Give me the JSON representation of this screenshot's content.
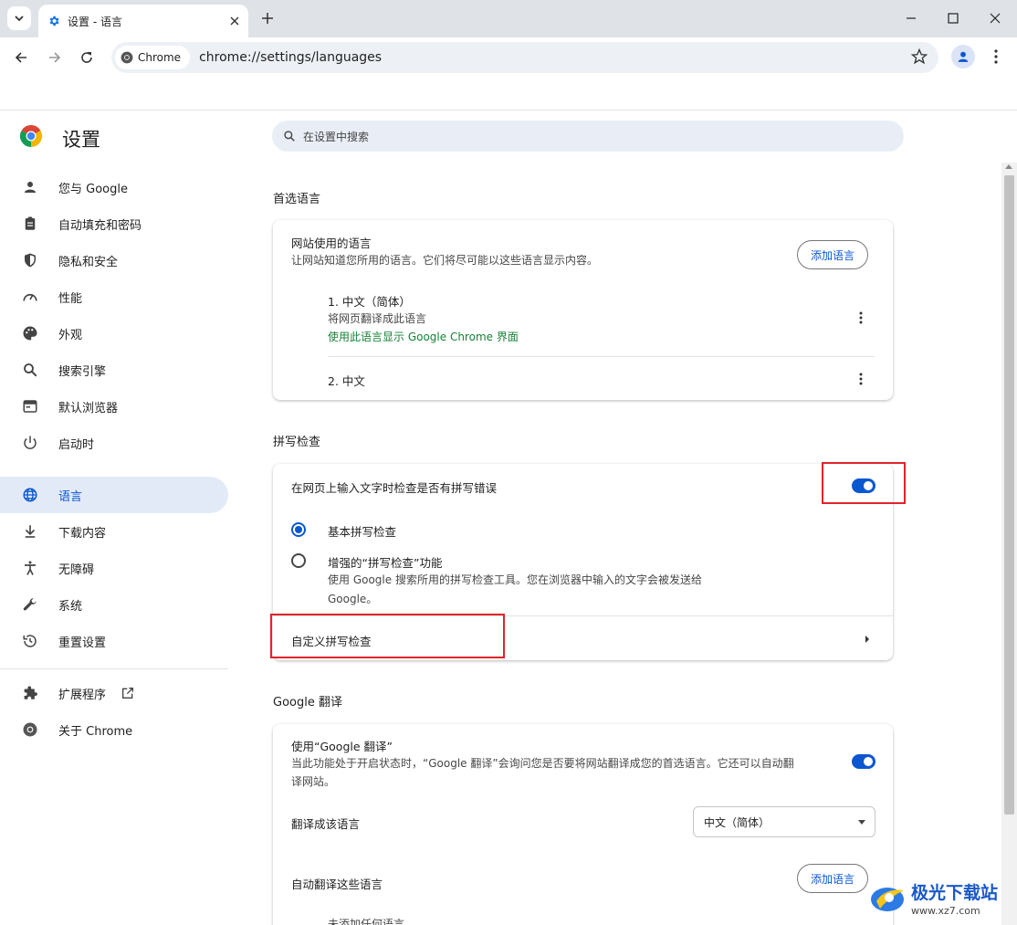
{
  "browser": {
    "tab_title": "设置 - 语言",
    "chip_label": "Chrome",
    "url": "chrome://settings/languages"
  },
  "settings": {
    "title": "设置",
    "search_placeholder": "在设置中搜索"
  },
  "sidebar": {
    "items": [
      {
        "label": "您与 Google",
        "icon": "person-icon"
      },
      {
        "label": "自动填充和密码",
        "icon": "clipboard-icon"
      },
      {
        "label": "隐私和安全",
        "icon": "shield-icon"
      },
      {
        "label": "性能",
        "icon": "speedometer-icon"
      },
      {
        "label": "外观",
        "icon": "palette-icon"
      },
      {
        "label": "搜索引擎",
        "icon": "search-icon"
      },
      {
        "label": "默认浏览器",
        "icon": "browser-window-icon"
      },
      {
        "label": "启动时",
        "icon": "power-icon"
      },
      {
        "label": "语言",
        "icon": "globe-icon",
        "active": true
      },
      {
        "label": "下载内容",
        "icon": "download-icon"
      },
      {
        "label": "无障碍",
        "icon": "accessibility-icon"
      },
      {
        "label": "系统",
        "icon": "wrench-icon"
      },
      {
        "label": "重置设置",
        "icon": "history-icon"
      }
    ],
    "extensions_label": "扩展程序",
    "about_label": "关于 Chrome"
  },
  "preferred_languages": {
    "section_title": "首选语言",
    "card_title": "网站使用的语言",
    "card_subtitle": "让网站知道您所用的语言。它们将尽可能以这些语言显示内容。",
    "add_button": "添加语言",
    "languages": [
      {
        "name": "1. 中文（简体）",
        "detail": "将网页翻译成此语言",
        "ui_note": "使用此语言显示 Google Chrome 界面"
      },
      {
        "name": "2. 中文"
      }
    ]
  },
  "spell_check": {
    "section_title": "拼写检查",
    "toggle_label": "在网页上输入文字时检查是否有拼写错误",
    "toggle_on": true,
    "basic_label": "基本拼写检查",
    "enhanced_label": "增强的“拼写检查”功能",
    "enhanced_desc_line1": "使用 Google 搜索所用的拼写检查工具。您在浏览器中输入的文字会被发送给",
    "enhanced_desc_line2": "Google。",
    "selected": "basic",
    "custom_label": "自定义拼写检查"
  },
  "translate": {
    "section_title": "Google 翻译",
    "use_label": "使用“Google 翻译”",
    "use_desc_line1": "当此功能处于开启状态时，“Google 翻译”会询问您是否要将网站翻译成您的首选语言。它还可以自动翻",
    "use_desc_line2": "译网站。",
    "toggle_on": true,
    "target_label": "翻译成该语言",
    "target_value": "中文（简体）",
    "auto_label": "自动翻译这些语言",
    "add_button": "添加语言",
    "none_added": "未添加任何语言"
  },
  "watermark": {
    "title": "极光下载站",
    "url": "www.xz7.com"
  },
  "colors": {
    "accent": "#0b57d0",
    "green": "#188038",
    "highlight": "#e0242b"
  }
}
